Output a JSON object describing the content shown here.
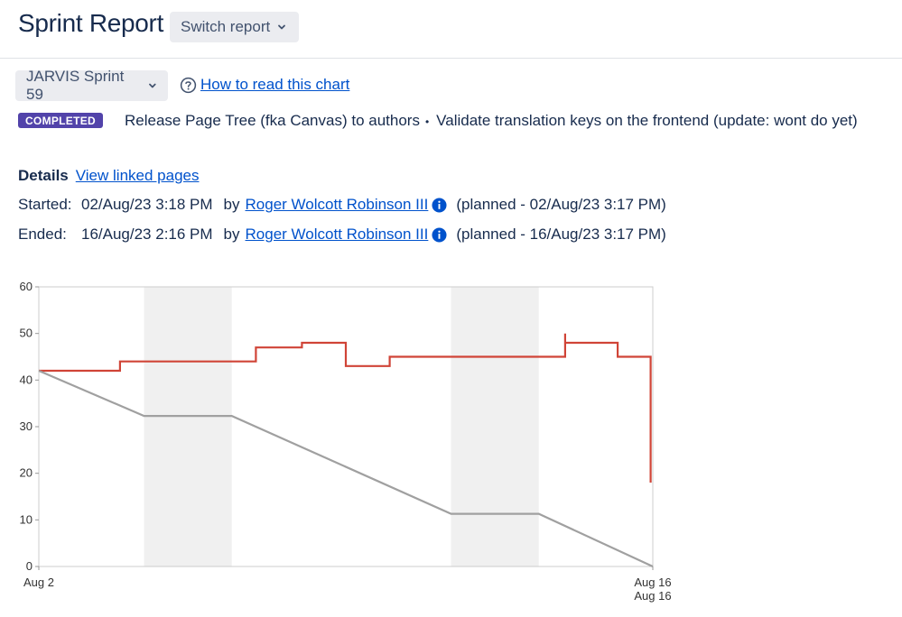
{
  "header": {
    "title": "Sprint Report",
    "switch_label": "Switch report"
  },
  "toolbar": {
    "sprint_label": "JARVIS Sprint 59",
    "howto_label": "How to read this chart"
  },
  "status": {
    "badge": "COMPLETED",
    "badge_color": "#5243aa"
  },
  "goals": [
    "Release Page Tree (fka Canvas) to authors",
    "Validate translation keys on the frontend (update: wont do yet)"
  ],
  "details": {
    "heading": "Details",
    "link": "View linked pages",
    "started": {
      "label": "Started:",
      "date": "02/Aug/23 3:18 PM",
      "by": "by",
      "user": "Roger Wolcott Robinson III",
      "planned": "(planned - 02/Aug/23 3:17 PM)"
    },
    "ended": {
      "label": "Ended:",
      "date": "16/Aug/23 2:16 PM",
      "by": "by",
      "user": "Roger Wolcott Robinson III",
      "planned": "(planned - 16/Aug/23 3:17 PM)"
    }
  },
  "chart_data": {
    "type": "line",
    "x_range": [
      0,
      14
    ],
    "ylim": [
      0,
      60
    ],
    "y_ticks": [
      0,
      10,
      20,
      30,
      40,
      50,
      60
    ],
    "x_tick_labels": [
      {
        "x": 0,
        "lines": [
          "Aug 2"
        ]
      },
      {
        "x": 14,
        "lines": [
          "Aug 16",
          "Aug 16"
        ]
      }
    ],
    "non_working_periods": [
      [
        2.4,
        4.4
      ],
      [
        9.4,
        11.4
      ]
    ],
    "grid": false,
    "series": [
      {
        "color": "#d04437",
        "step": true,
        "points": [
          [
            0,
            42
          ],
          [
            1.85,
            42
          ],
          [
            1.85,
            44
          ],
          [
            4.95,
            44
          ],
          [
            4.95,
            47
          ],
          [
            6.0,
            47
          ],
          [
            6.0,
            48
          ],
          [
            7.0,
            48
          ],
          [
            7.0,
            43
          ],
          [
            8.0,
            43
          ],
          [
            8.0,
            45
          ],
          [
            12.0,
            45
          ],
          [
            12.0,
            50
          ],
          [
            12.0,
            48
          ],
          [
            13.2,
            48
          ],
          [
            13.2,
            45
          ],
          [
            13.95,
            45
          ],
          [
            13.95,
            18
          ]
        ]
      },
      {
        "color": "#a0a0a0",
        "step": false,
        "points": [
          [
            0,
            42
          ],
          [
            2.4,
            32.3
          ],
          [
            4.4,
            32.3
          ],
          [
            9.4,
            11.3
          ],
          [
            11.4,
            11.3
          ],
          [
            14,
            0
          ]
        ]
      }
    ]
  },
  "colors": {
    "link": "#0052cc",
    "text": "#172b4d",
    "button_bg": "#ebecf0",
    "weekend_band": "#f0f0f0"
  }
}
